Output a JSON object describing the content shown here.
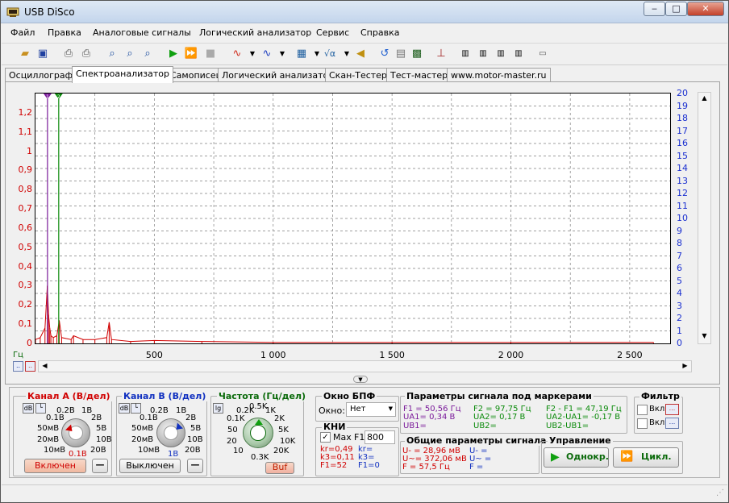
{
  "window": {
    "title": "USB DiSco",
    "min": "‒",
    "max": "□",
    "close": "✕"
  },
  "menu": [
    "Файл",
    "Правка",
    "Аналоговые сигналы",
    "Логический анализатор",
    "Сервис",
    "Справка"
  ],
  "tabs": [
    "Осциллограф",
    "Спектроанализатор",
    "Самописец",
    "Логический анализатор",
    "Скан-Тестер",
    "Тест-мастер",
    "www.motor-master.ru"
  ],
  "active_tab": 1,
  "chart_data": {
    "type": "line",
    "y_left_ticks": [
      "1,2",
      "1,1",
      "1",
      "0,9",
      "0,8",
      "0,7",
      "0,6",
      "0,5",
      "0,4",
      "0,3",
      "0,2",
      "0,1",
      "0"
    ],
    "y_right_ticks": [
      "20",
      "19",
      "18",
      "17",
      "16",
      "15",
      "14",
      "13",
      "12",
      "11",
      "10",
      "9",
      "8",
      "7",
      "6",
      "5",
      "4",
      "3",
      "2",
      "1",
      "0"
    ],
    "x_ticks": [
      "500",
      "1 000",
      "1 500",
      "2 000",
      "2 500"
    ],
    "x_tick_values": [
      500,
      1000,
      1500,
      2000,
      2500
    ],
    "xlim": [
      0,
      2670
    ],
    "ylim_left": [
      0,
      1.3
    ],
    "xlabel": "Гц",
    "series": [
      {
        "color": "#d00000",
        "x": [
          0,
          20,
          40,
          50,
          55,
          60,
          65,
          75,
          90,
          100,
          110,
          150,
          160,
          200,
          250,
          300,
          310,
          320,
          400,
          500,
          700,
          1000,
          1500,
          2000,
          2600
        ],
        "y": [
          0.02,
          0.03,
          0.08,
          0.3,
          0.15,
          0.08,
          0.04,
          0.03,
          0.04,
          0.12,
          0.03,
          0.02,
          0.04,
          0.02,
          0.02,
          0.03,
          0.11,
          0.02,
          0.01,
          0.015,
          0.01,
          0.005,
          0.005,
          0.005,
          0.005
        ]
      }
    ],
    "markers": [
      {
        "name": "1",
        "x": 50.56,
        "color": "#7a1a9a"
      },
      {
        "name": "2",
        "x": 97.75,
        "color": "#0a8a0a"
      }
    ],
    "grid": true
  },
  "chanA": {
    "title": "Канал A (В/дел)",
    "ticks": [
      "0.2В",
      "1В",
      "0.1В",
      "2В",
      "50мВ",
      "5В",
      "20мВ",
      "10В",
      "10мВ",
      "20В"
    ],
    "value": "0.1В",
    "button": "Включен",
    "minus": "—"
  },
  "chanB": {
    "title": "Канал B (В/дел)",
    "ticks": [
      "0.2В",
      "1В",
      "0.1В",
      "2В",
      "50мВ",
      "5В",
      "20мВ",
      "10В",
      "10мВ",
      "20В"
    ],
    "value": "1В",
    "button": "Выключен",
    "minus": "—"
  },
  "freq": {
    "title": "Частота (Гц/дел)",
    "lg": "lg",
    "ticks": [
      "0.5K",
      "0.2K",
      "1K",
      "0.1K",
      "2K",
      "50",
      "5K",
      "20",
      "10K",
      "10",
      "20K",
      "0.3K"
    ],
    "buf": "Buf"
  },
  "fft": {
    "title": "Окно БПФ",
    "label": "Окно:",
    "value": "Нет"
  },
  "kni": {
    "title": "КНИ",
    "max": "Max",
    "f1_label": "F1",
    "f1_value": "800",
    "kr": "kr=0,49",
    "k3": "k3=0,11",
    "f1": "F1=52",
    "kr2": "kr=",
    "k3_2": "k3=",
    "f1_2": "F1=0"
  },
  "markers_params": {
    "title": "Параметры сигнала под маркерами",
    "f1": "F1 = 50,56 Гц",
    "f2": "F2 = 97,75 Гц",
    "df": "F2 - F1 = 47,19 Гц",
    "ua1": "UA1= 0,34 В",
    "ua2": "UA2= 0,17 В",
    "dua": "UA2-UA1= -0,17 В",
    "ub1": "UB1=",
    "ub2": "UB2=",
    "dub": "UB2-UB1="
  },
  "common": {
    "title": "Общие параметры сигнала",
    "u_minus": "U- = 28,96 мВ",
    "u_tilde": "U~= 372,06 мВ",
    "f": "F = 57,5 Гц",
    "u_minus2": "U- =",
    "u_tilde2": "U~ =",
    "f2": "F ="
  },
  "filter": {
    "title": "Фильтр",
    "on1": "Вкл",
    "on2": "Вкл",
    "btn": "..."
  },
  "control": {
    "title": "Управление",
    "single": "Однокр.",
    "cycle": "Цикл."
  },
  "colors": {
    "chanA": "#d00000",
    "chanB": "#1030c0",
    "freq": "#0a6a0a",
    "marker1": "#7a1a9a",
    "marker2": "#0a8a0a",
    "grid": "#808080"
  },
  "small_btn": ".."
}
